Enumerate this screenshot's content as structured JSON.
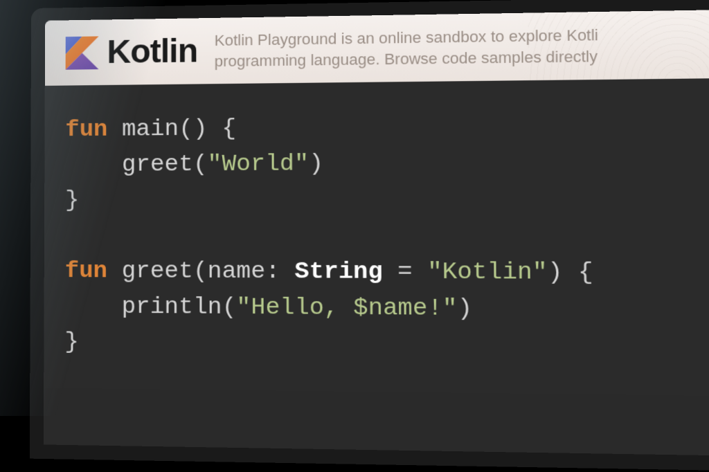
{
  "header": {
    "brand": "Kotlin",
    "tagline_line1": "Kotlin Playground is an online sandbox to explore Kotli",
    "tagline_line2": "programming language. Browse code samples directly"
  },
  "code": {
    "line1": {
      "keyword": "fun",
      "fname": "main",
      "parens": "()",
      "brace": "{"
    },
    "line2": {
      "indent": "    ",
      "call": "greet",
      "open": "(",
      "arg_str": "\"World\"",
      "close": ")"
    },
    "line3": {
      "brace": "}"
    },
    "line4": "",
    "line5": {
      "keyword": "fun",
      "fname": "greet",
      "open": "(",
      "param": "name",
      "colon": ": ",
      "type": "String",
      "eq": " = ",
      "default_str": "\"Kotlin\"",
      "close": ")",
      "brace": " {"
    },
    "line6": {
      "indent": "    ",
      "call": "println",
      "open": "(",
      "arg_str_pre": "\"Hello, ",
      "tmpl": "$name",
      "arg_str_post": "!\"",
      "close": ")"
    },
    "line7": {
      "brace": "}"
    }
  },
  "colors": {
    "keyword": "#e08538",
    "string": "#b7ca8d",
    "type": "#ffffff",
    "editor_bg": "#2b2b2b",
    "header_bg": "#f2ece8"
  }
}
